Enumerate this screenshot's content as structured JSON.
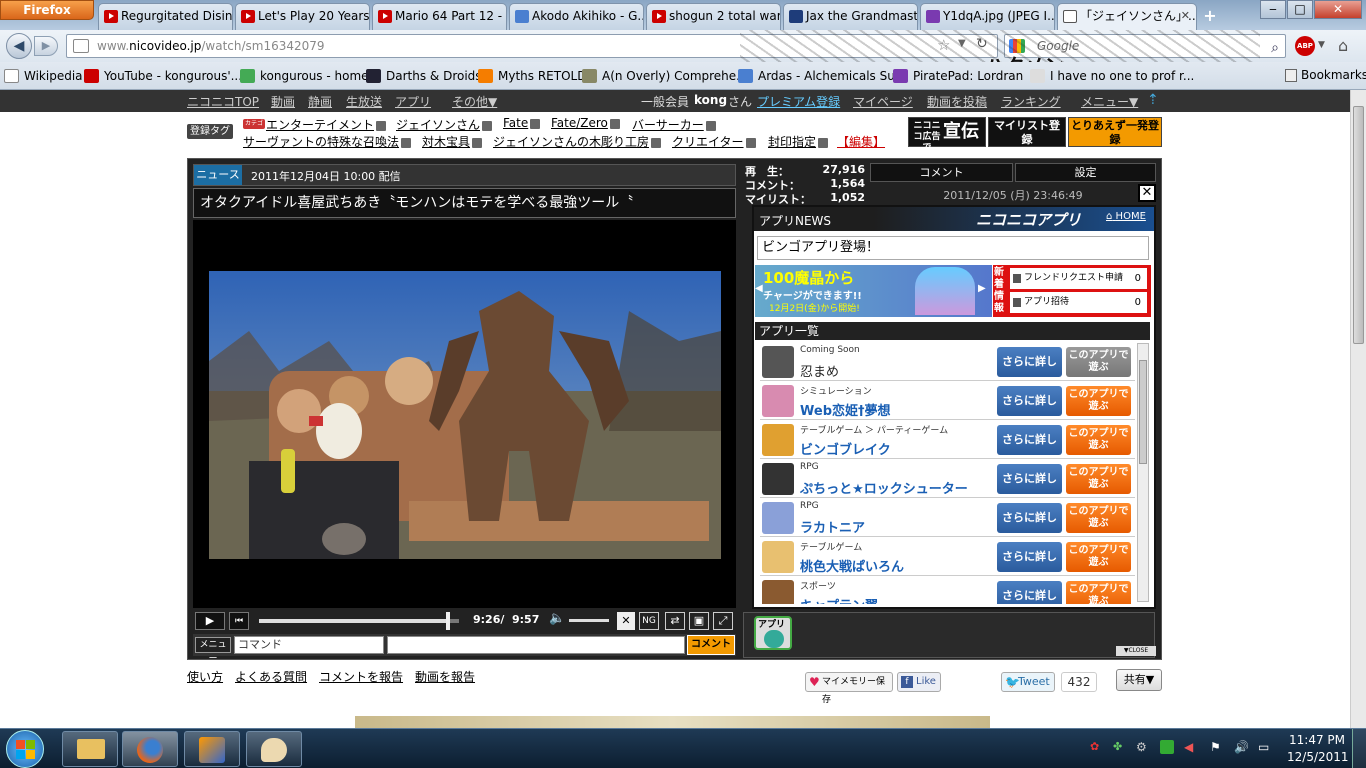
{
  "browser": {
    "menu_button": "Firefox",
    "tabs": [
      {
        "label": "Regurgitated Disin...",
        "icon": "youtube-icon"
      },
      {
        "label": "Let's Play 20 Years ...",
        "icon": "youtube-icon"
      },
      {
        "label": "Mario 64 Part 12 - ...",
        "icon": "youtube-icon"
      },
      {
        "label": "Akodo Akihiko - G...",
        "icon": "google-docs-icon"
      },
      {
        "label": "shogun 2 total war...",
        "icon": "youtube-icon"
      },
      {
        "label": "Jax the Grandmast...",
        "icon": "wiki-icon"
      },
      {
        "label": "Y1dqA.jpg (JPEG I...",
        "icon": "image-icon"
      },
      {
        "label": "「ジェイソンさん」...",
        "icon": "niconico-icon"
      }
    ],
    "new_tab": "+",
    "url_prefix": "www.",
    "url_domain": "nicovideo.jp",
    "url_path": "/watch/sm16342079",
    "search_placeholder": "Google",
    "window_buttons": {
      "min": "‒",
      "max": "□",
      "close": "✕"
    },
    "bookmarks": [
      {
        "label": "Wikipedia",
        "icon": "wikipedia-icon"
      },
      {
        "label": "YouTube - kongurous'...",
        "icon": "youtube-icon"
      },
      {
        "label": "kongurous - home",
        "icon": "deviantart-icon"
      },
      {
        "label": "Darths & Droids",
        "icon": "darths-icon"
      },
      {
        "label": "Myths RETOLD",
        "icon": "blogger-icon"
      },
      {
        "label": "A(n Overly) Comprehe...",
        "icon": "sword-icon"
      },
      {
        "label": "Ardas - Alchemicals Su...",
        "icon": "google-docs-icon"
      },
      {
        "label": "PiratePad: Lordran",
        "icon": "piratepad-icon"
      },
      {
        "label": "I have no one to prof r...",
        "icon": "page-icon"
      }
    ],
    "bookmarks_menu": "Bookmarks",
    "persona_text": "ハクメン"
  },
  "nico": {
    "nav_left": [
      "ニコニコTOP",
      "動画",
      "静画",
      "生放送",
      "アプリ",
      "その他▼"
    ],
    "member_prefix": "一般会員",
    "user": "kong",
    "san": "さん",
    "nav_right": [
      "プレミアム登録",
      "マイページ",
      "動画を投稿",
      "ランキング",
      "メニュー▼"
    ],
    "tags_label": "登録タグ",
    "category_badge": "カテゴリ",
    "tags_row1": [
      "エンターテイメント",
      "ジェイソンさん",
      "Fate",
      "Fate/Zero",
      "バーサーカー"
    ],
    "tags_row2": [
      "サーヴァントの特殊な召喚法",
      "対木宝具",
      "ジェイソンさんの木彫り工房",
      "クリエイター",
      "封印指定"
    ],
    "edit_tags": "【編集】",
    "ad_buttons": [
      "ニコニコ広告で",
      "宣伝",
      "マイリスト登録",
      "とりあえず一発登録"
    ]
  },
  "player": {
    "news_label": "ニュース",
    "news_date": "2011年12月04日 10:00 配信",
    "news_title": "オタクアイドル喜屋武ちあき〝モンハンはモテを学べる最強ツール〝",
    "stats": [
      {
        "label": "再　生：",
        "value": "27,916"
      },
      {
        "label": "コメント：",
        "value": "1,564"
      },
      {
        "label": "マイリスト：",
        "value": "1,052"
      }
    ],
    "tab_comment": "コメント",
    "tab_settings": "設定",
    "timestamp": "2011/12/05 (月) 23:46:49",
    "current_time": "9:26/",
    "total_time": "9:57",
    "progress": 0.946,
    "ng_label": "NG",
    "menu_label": "メニュー",
    "command_placeholder": "コマンド",
    "comment_button": "コメント",
    "app_button": "アプリ",
    "close_label": "▼CLOSE"
  },
  "appnews": {
    "header": "アプリNEWS",
    "brand": "ニコニコアプリ",
    "home": "HOME",
    "headline": "ビンゴアプリ登場！",
    "banner_main": "100魔晶から",
    "banner_sub": "チャージができます!!",
    "banner_date": "12月2日(金)から開始!",
    "new_info": "新着情報",
    "friend_request": "フレンドリクエスト申請",
    "friend_count": "0",
    "app_invite": "アプリ招待",
    "invite_count": "0",
    "list_header": "アプリ一覧",
    "detail_button": "さらに詳しく",
    "play_button": "このアプリで遊ぶ",
    "apps": [
      {
        "category": "Coming Soon",
        "name": "忍まめ",
        "avatar_color": "#555",
        "coming": true
      },
      {
        "category": "シミュレーション",
        "name": "Web恋姫†夢想",
        "avatar_color": "#d88bb0",
        "coming": false
      },
      {
        "category": "テーブルゲーム ＞ パーティーゲーム",
        "name": "ビンゴブレイク",
        "avatar_color": "#e0a030",
        "coming": false
      },
      {
        "category": "RPG",
        "name": "ぷちっと★ロックシューター",
        "avatar_color": "#333",
        "coming": false
      },
      {
        "category": "RPG",
        "name": "ラカトニア",
        "avatar_color": "#8aa0d8",
        "coming": false
      },
      {
        "category": "テーブルゲーム",
        "name": "桃色大戦ぱいろん",
        "avatar_color": "#e8c070",
        "coming": false
      },
      {
        "category": "スポーツ",
        "name": "キャプテン翼",
        "avatar_color": "#8a5a30",
        "coming": false
      }
    ]
  },
  "footer": {
    "links": [
      "使い方",
      "よくある質問",
      "コメントを報告",
      "動画を報告"
    ],
    "memory": "マイメモリー保存",
    "like": "Like",
    "tweet": "Tweet",
    "tweet_count": "432",
    "share": "共有▼"
  },
  "taskbar": {
    "time": "11:47 PM",
    "date": "12/5/2011"
  }
}
